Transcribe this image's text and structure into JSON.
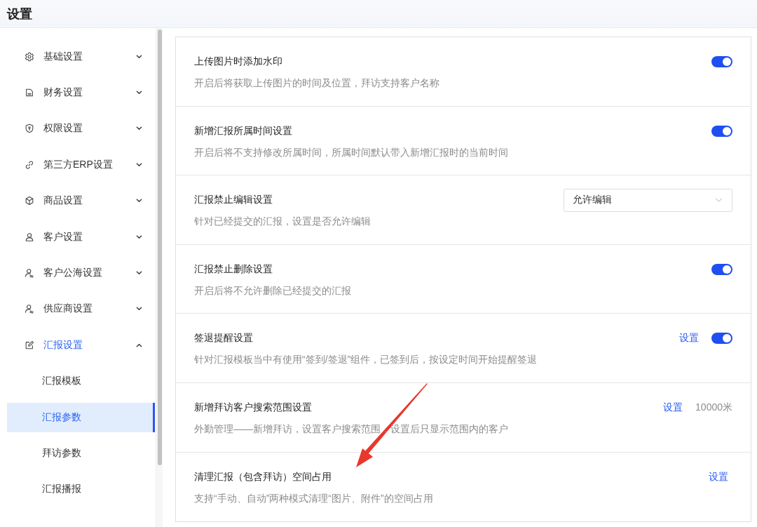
{
  "header": {
    "title": "设置"
  },
  "sidebar": {
    "items": [
      {
        "label": "基础设置",
        "expanded": false
      },
      {
        "label": "财务设置",
        "expanded": false
      },
      {
        "label": "权限设置",
        "expanded": false
      },
      {
        "label": "第三方ERP设置",
        "expanded": false
      },
      {
        "label": "商品设置",
        "expanded": false
      },
      {
        "label": "客户设置",
        "expanded": false
      },
      {
        "label": "客户公海设置",
        "expanded": false
      },
      {
        "label": "供应商设置",
        "expanded": false
      },
      {
        "label": "汇报设置",
        "expanded": true,
        "children": [
          {
            "label": "汇报模板",
            "selected": false
          },
          {
            "label": "汇报参数",
            "selected": true
          },
          {
            "label": "拜访参数",
            "selected": false
          },
          {
            "label": "汇报播报",
            "selected": false
          }
        ]
      }
    ]
  },
  "settings": {
    "rows": [
      {
        "title": "上传图片时添加水印",
        "description": "开启后将获取上传图片的时间及位置，拜访支持客户名称",
        "actions": [
          {
            "kind": "toggle",
            "on": true
          }
        ]
      },
      {
        "title": "新增汇报所属时间设置",
        "description": "开启后将不支持修改所属时间，所属时间默认带入新增汇报时的当前时间",
        "actions": [
          {
            "kind": "toggle",
            "on": true
          }
        ]
      },
      {
        "title": "汇报禁止编辑设置",
        "description": "针对已经提交的汇报，设置是否允许编辑",
        "actions": [
          {
            "kind": "select",
            "value": "允许编辑"
          }
        ]
      },
      {
        "title": "汇报禁止删除设置",
        "description": "开启后将不允许删除已经提交的汇报",
        "actions": [
          {
            "kind": "toggle",
            "on": true
          }
        ]
      },
      {
        "title": "签退提醒设置",
        "description": "针对汇报模板当中有使用“签到/签退”组件，已签到后，按设定时间开始提醒签退",
        "actions": [
          {
            "kind": "link",
            "label": "设置"
          },
          {
            "kind": "toggle",
            "on": true
          }
        ]
      },
      {
        "title": "新增拜访客户搜索范围设置",
        "description": "外勤管理——新增拜访，设置客户搜索范围，设置后只显示范围内的客户",
        "actions": [
          {
            "kind": "link",
            "label": "设置"
          },
          {
            "kind": "value",
            "text": "10000米"
          }
        ]
      },
      {
        "title": "清理汇报（包含拜访）空间占用",
        "description": "支持“手动、自动”两种模式清理“图片、附件”的空间占用",
        "actions": [
          {
            "kind": "link",
            "label": "设置"
          }
        ]
      }
    ]
  },
  "annotations": [
    {
      "kind": "arrow"
    }
  ]
}
